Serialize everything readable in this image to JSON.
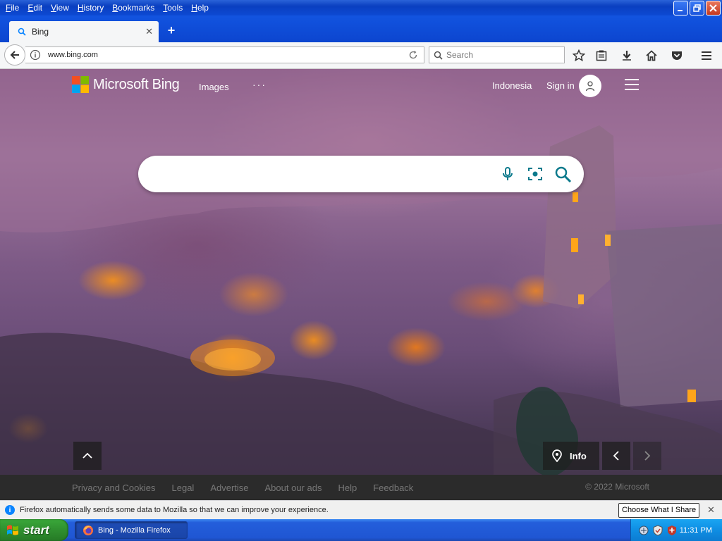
{
  "window": {
    "menu": [
      "File",
      "Edit",
      "View",
      "History",
      "Bookmarks",
      "Tools",
      "Help"
    ]
  },
  "tab": {
    "title": "Bing",
    "new_tab": "+"
  },
  "navbar": {
    "url": "www.bing.com",
    "search_placeholder": "Search"
  },
  "bing": {
    "logo_text": "Microsoft Bing",
    "nav_images": "Images",
    "nav_more": "···",
    "region": "Indonesia",
    "sign_in": "Sign in",
    "info_label": "Info",
    "footer_links": [
      "Privacy and Cookies",
      "Legal",
      "Advertise",
      "About our ads",
      "Help",
      "Feedback"
    ],
    "copyright": "© 2022 Microsoft"
  },
  "notification": {
    "text": "Firefox automatically sends some data to Mozilla so that we can improve your experience.",
    "button": "Choose What I Share"
  },
  "taskbar": {
    "start": "start",
    "task_label": "Bing - Mozilla Firefox",
    "clock": "11:31 PM"
  },
  "colors": {
    "xp_blue": "#0a3fc0",
    "bing_accent": "#0c7a8c",
    "footer_bg": "#2b2b2b",
    "start_green": "#2f8f2f"
  }
}
